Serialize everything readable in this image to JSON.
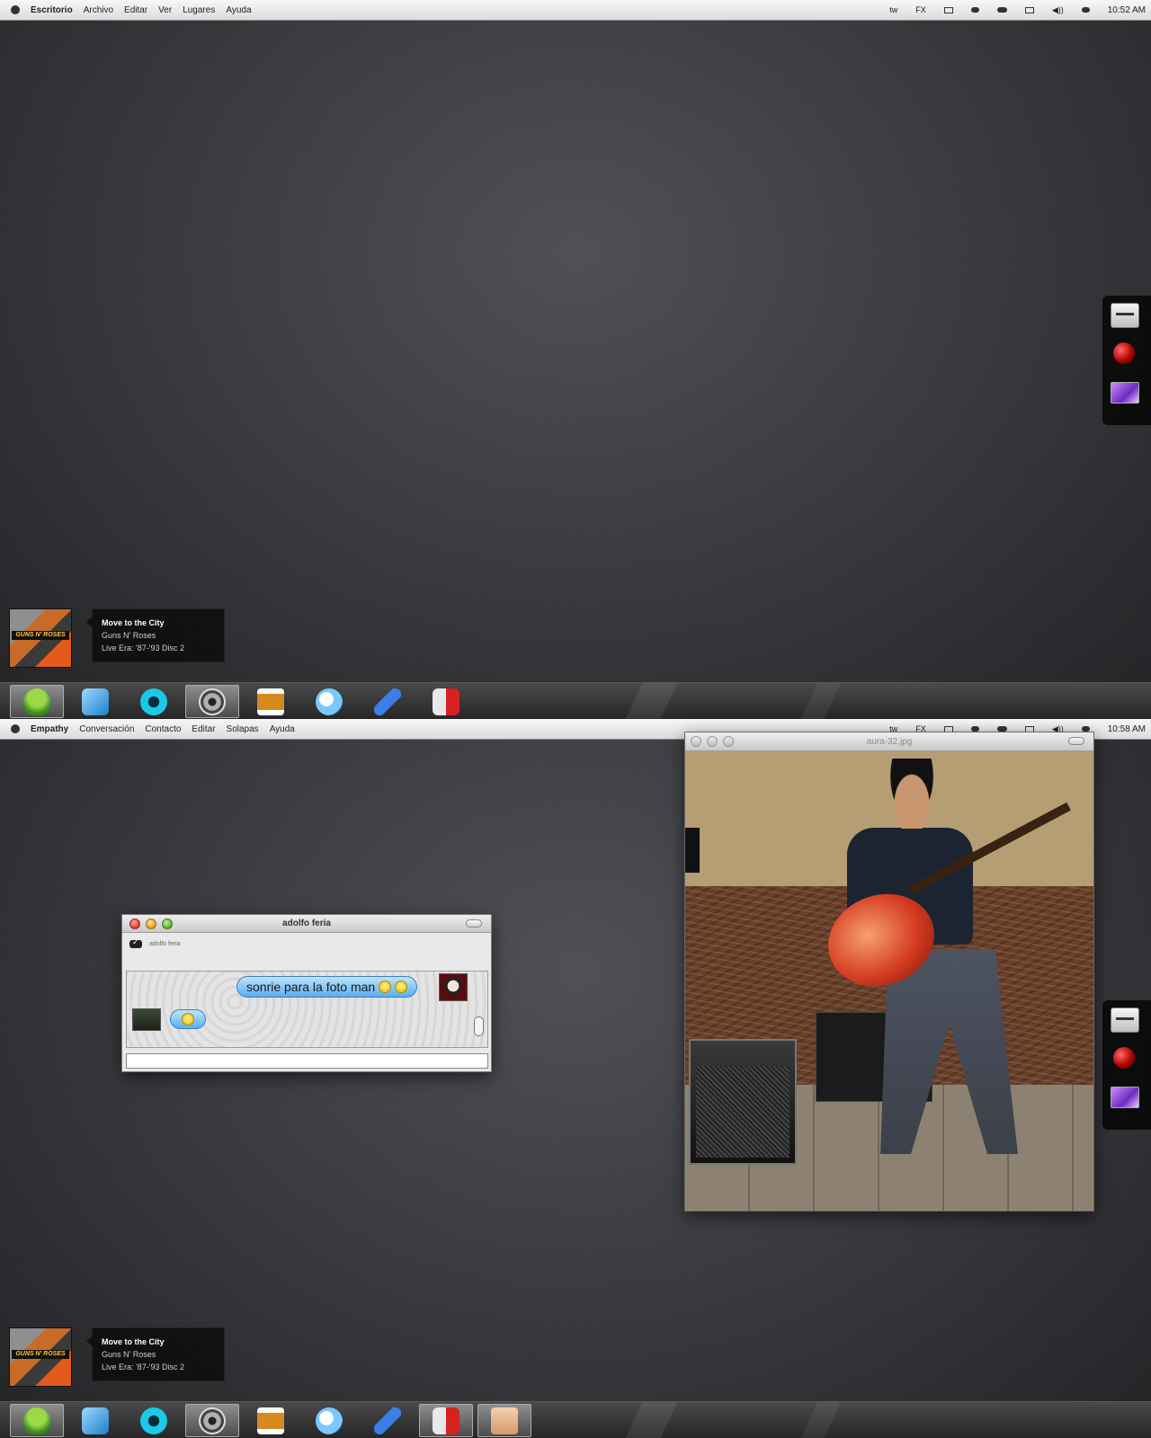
{
  "screens": [
    {
      "menubar": {
        "app_name": "Escritorio",
        "menus": [
          "Archivo",
          "Editar",
          "Ver",
          "Lugares",
          "Ayuda"
        ],
        "tray": [
          "tw",
          "FX"
        ],
        "clock": "10:52 AM"
      },
      "now_playing": {
        "title": "Move to the City",
        "artist": "Guns N' Roses",
        "album": "Live Era: '87-'93 Disc 2",
        "album_art_text": "GUNS N' ROSES"
      },
      "dock": {
        "items": [
          "pidgin-icon",
          "twitter-client-icon",
          "webcam-icon",
          "camera-icon",
          "whiskey-icon",
          "itunes-icon",
          "feather-icon",
          "finder-icon"
        ],
        "active": [
          0,
          3
        ]
      }
    },
    {
      "menubar": {
        "app_name": "Empathy",
        "menus": [
          "Conversación",
          "Contacto",
          "Editar",
          "Solapas",
          "Ayuda"
        ],
        "tray": [
          "tw",
          "FX"
        ],
        "clock": "10:58 AM"
      },
      "chat_window": {
        "title": "adolfo feria",
        "contact_name": "adolfo feria",
        "messages": [
          {
            "from": "me",
            "text": "sonrie para la foto man",
            "emoticons": 2
          },
          {
            "from": "contact",
            "text": "",
            "emoticons": 1
          }
        ],
        "input_value": ""
      },
      "image_window": {
        "title": "aura-32.jpg"
      },
      "now_playing": {
        "title": "Move to the City",
        "artist": "Guns N' Roses",
        "album": "Live Era: '87-'93 Disc 2",
        "album_art_text": "GUNS N' ROSES"
      },
      "dock": {
        "items": [
          "pidgin-icon",
          "twitter-client-icon",
          "webcam-icon",
          "camera-icon",
          "whiskey-icon",
          "itunes-icon",
          "feather-icon",
          "finder-icon",
          "eye-of-gnome-icon"
        ],
        "active": [
          0,
          3,
          7,
          8
        ]
      }
    }
  ]
}
